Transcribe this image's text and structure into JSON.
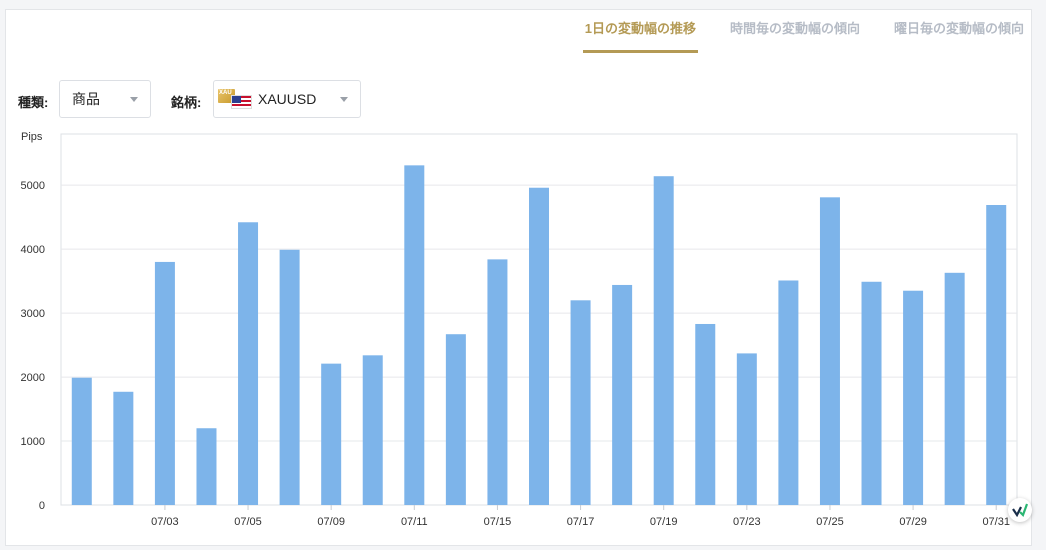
{
  "tabs": [
    {
      "label": "1日の変動幅の推移",
      "active": true
    },
    {
      "label": "時間毎の変動幅の傾向",
      "active": false
    },
    {
      "label": "曜日毎の変動幅の傾向",
      "active": false
    }
  ],
  "filters": {
    "type_label": "種類:",
    "type_value": "商品",
    "symbol_label": "銘柄:",
    "symbol_value": "XAUUSD",
    "symbol_flag_text": "XAU"
  },
  "colors": {
    "bar": "#7db4ea",
    "accent": "#b49a55",
    "grid": "#e6e8eb"
  },
  "chart_data": {
    "type": "bar",
    "ylabel": "Pips",
    "ylim": [
      0,
      5800
    ],
    "yticks": [
      0,
      1000,
      2000,
      3000,
      4000,
      5000
    ],
    "grid": true,
    "categories": [
      "07/01",
      "07/02",
      "07/03",
      "07/04",
      "07/05",
      "07/08",
      "07/09",
      "07/10",
      "07/11",
      "07/12",
      "07/15",
      "07/16",
      "07/17",
      "07/18",
      "07/19",
      "07/22",
      "07/23",
      "07/24",
      "07/25",
      "07/26",
      "07/29",
      "07/30",
      "07/31"
    ],
    "xtick_labels": [
      "",
      "",
      "07/03",
      "",
      "07/05",
      "",
      "07/09",
      "",
      "07/11",
      "",
      "07/15",
      "",
      "07/17",
      "",
      "07/19",
      "",
      "07/23",
      "",
      "07/25",
      "",
      "07/29",
      "",
      "07/31"
    ],
    "values": [
      1990,
      1770,
      3800,
      1200,
      4420,
      3990,
      2210,
      2340,
      5310,
      2670,
      3840,
      4960,
      3200,
      3440,
      5140,
      2830,
      2370,
      3510,
      4810,
      3490,
      3350,
      3630,
      4690
    ]
  }
}
